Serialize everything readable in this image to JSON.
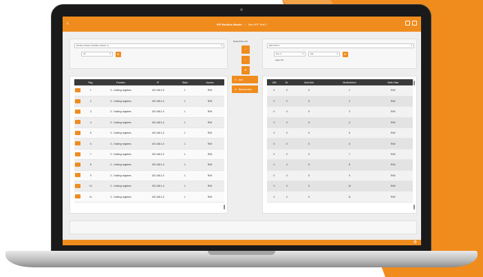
{
  "colors": {
    "accent": "#f08c1e",
    "header": "#3a3a3a"
  },
  "app": {
    "title": "IEP Modbus Master",
    "separator": "|",
    "subtitle": "Mon IEP Test 1"
  },
  "left_panel": {
    "master_select": "Modbus Master (ModBus Master 1)",
    "sub_select": "All"
  },
  "center_panel": {
    "label": "Read-Write-Info"
  },
  "right_panel": {
    "device_select": "IED-SubS 1",
    "select_a": "Dev 0",
    "select_b": "Idle",
    "small_text": "page info"
  },
  "actions": {
    "add_label": "Add",
    "remove_label": "Remove this"
  },
  "left_table": {
    "columns": [
      "",
      "Reg.",
      "Function",
      "IP",
      "Stato",
      "Access"
    ],
    "rows": [
      [
        "1",
        "3 - Holding registers",
        "192.168.1.6",
        "1",
        "R/W"
      ],
      [
        "2",
        "3 - Holding registers",
        "192.168.1.6",
        "1",
        "R/W"
      ],
      [
        "3",
        "3 - Holding registers",
        "192.168.1.6",
        "1",
        "R/W"
      ],
      [
        "4",
        "3 - Holding registers",
        "192.168.1.6",
        "1",
        "R/W"
      ],
      [
        "5",
        "3 - Holding registers",
        "192.168.1.6",
        "1",
        "R/W"
      ],
      [
        "6",
        "3 - Holding registers",
        "192.168.1.6",
        "1",
        "R/W"
      ],
      [
        "7",
        "3 - Holding registers",
        "192.168.1.6",
        "1",
        "R/W"
      ],
      [
        "8",
        "3 - Holding registers",
        "192.168.1.6",
        "1",
        "R/W"
      ],
      [
        "9",
        "3 - Holding registers",
        "192.168.1.6",
        "1",
        "R/W"
      ],
      [
        "10",
        "3 - Holding registers",
        "192.168.1.6",
        "1",
        "R/W"
      ],
      [
        "11",
        "3 - Holding registers",
        "192.168.1.6",
        "1",
        "R/W"
      ]
    ]
  },
  "right_table": {
    "columns": [
      "UNI",
      "DL",
      "Mod.Add",
      "ModbusNum",
      "Write Data"
    ],
    "rows": [
      [
        "0",
        "0",
        "5",
        "1",
        "R/W"
      ],
      [
        "0",
        "0",
        "5",
        "2",
        "R/W"
      ],
      [
        "0",
        "0",
        "5",
        "3",
        "R/W"
      ],
      [
        "0",
        "0",
        "5",
        "4",
        "R/W"
      ],
      [
        "0",
        "0",
        "5",
        "5",
        "R/W"
      ],
      [
        "0",
        "0",
        "5",
        "6",
        "R/W"
      ],
      [
        "0",
        "0",
        "5",
        "7",
        "R/W"
      ],
      [
        "0",
        "0",
        "5",
        "8",
        "R/W"
      ],
      [
        "0",
        "0",
        "5",
        "9",
        "R/W"
      ],
      [
        "0",
        "0",
        "5",
        "10",
        "R/W"
      ],
      [
        "0",
        "0",
        "5",
        "11",
        "R/W"
      ]
    ]
  }
}
